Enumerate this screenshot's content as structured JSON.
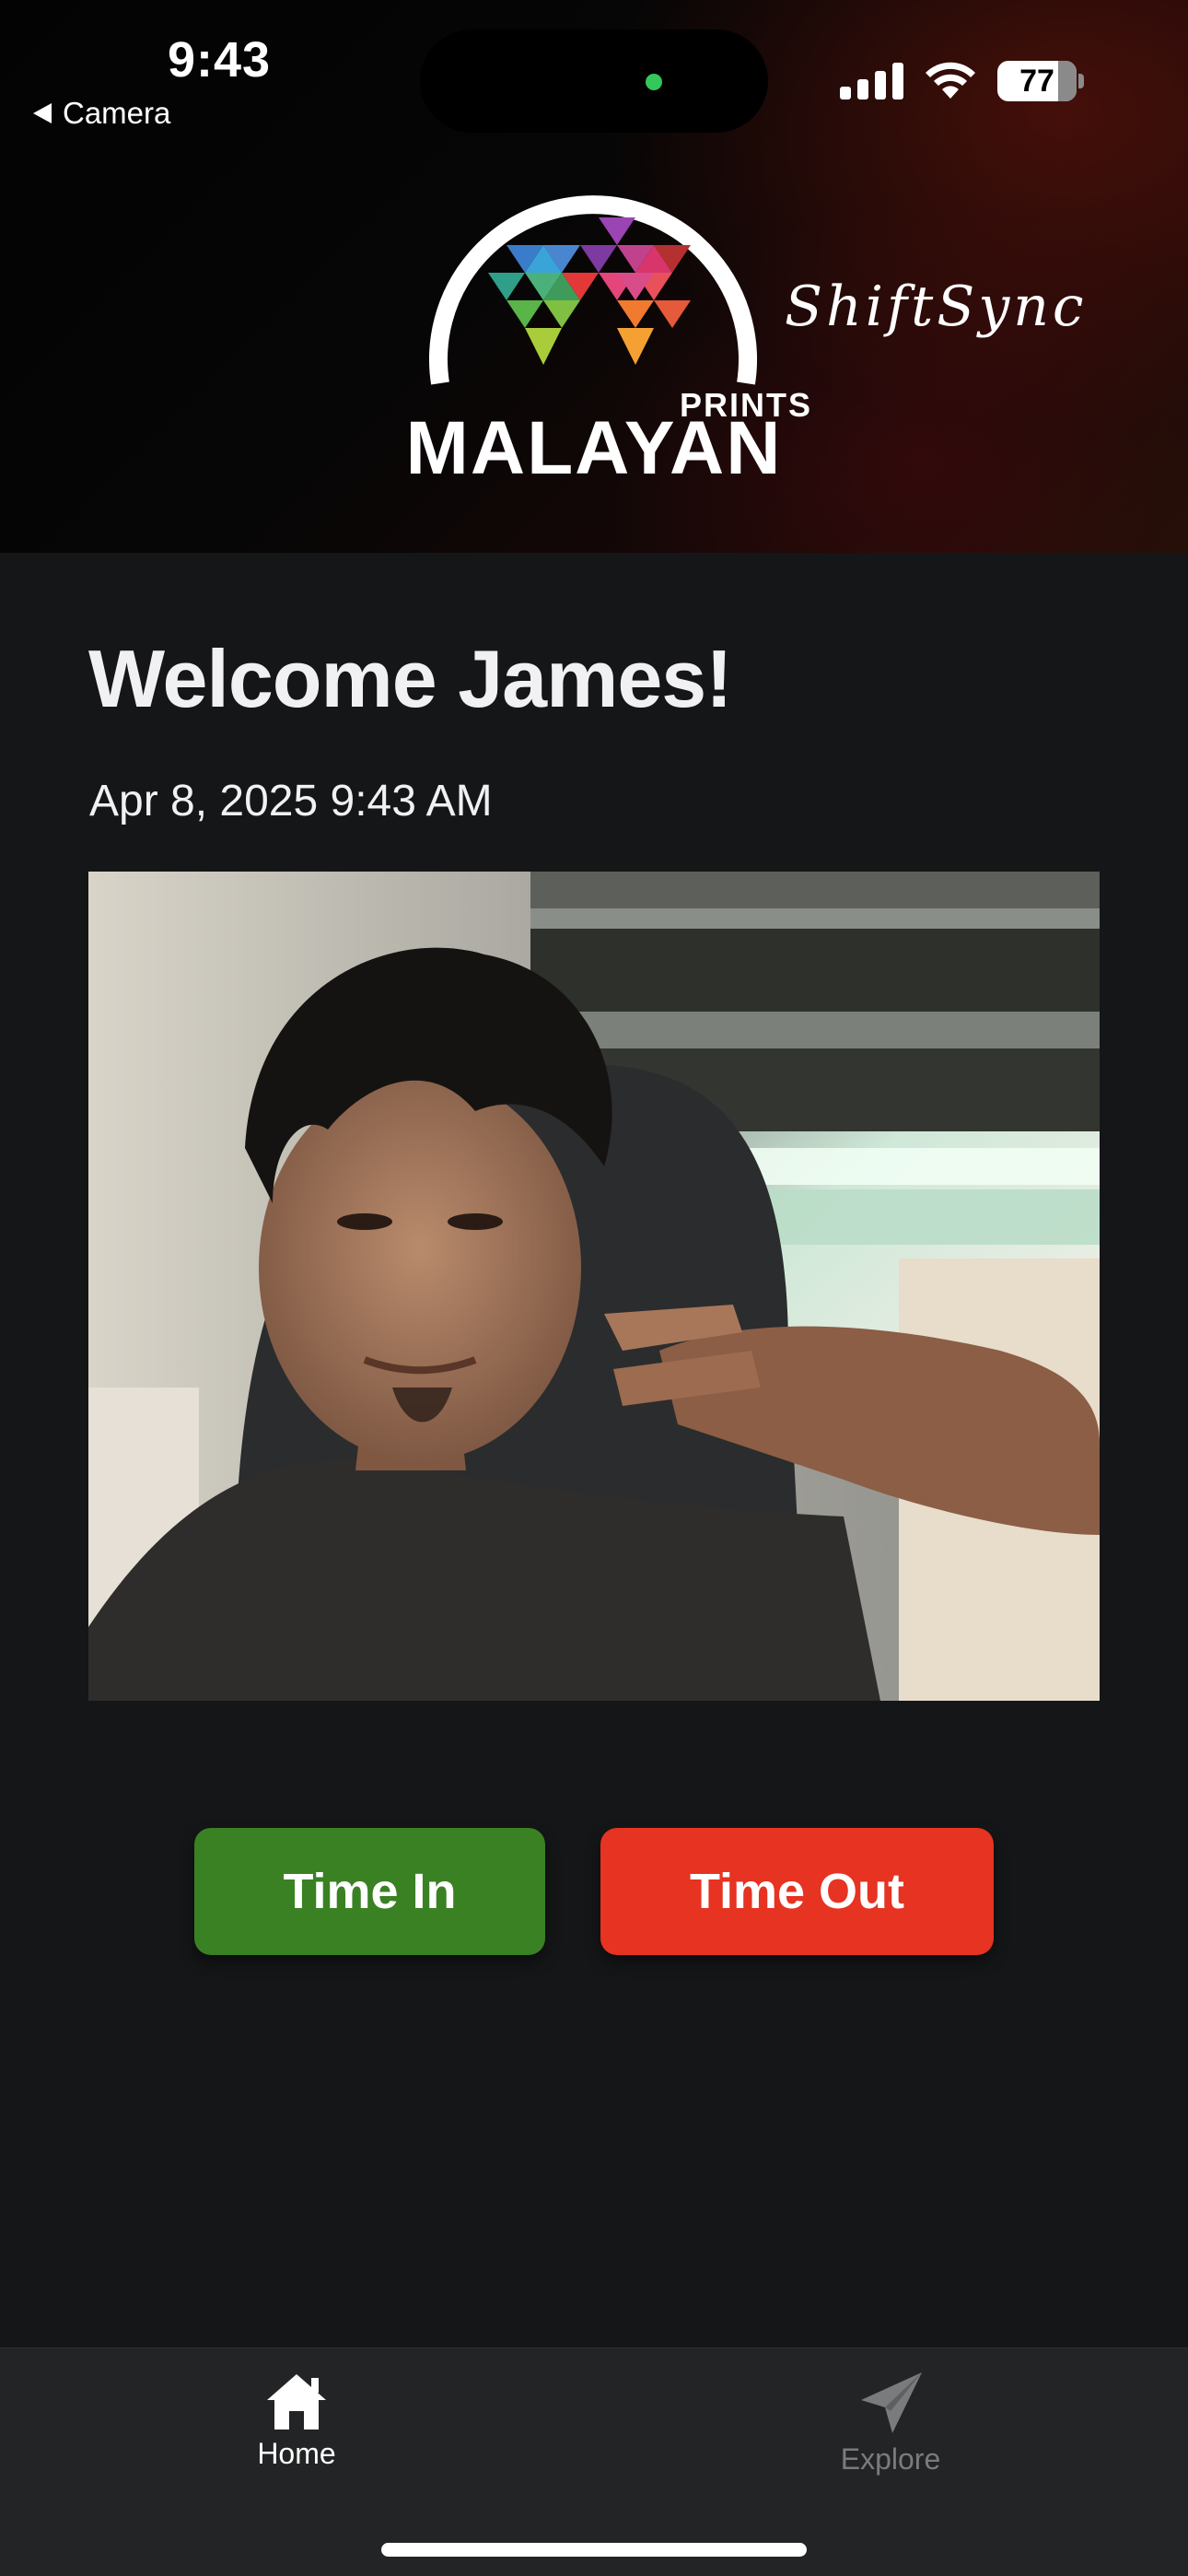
{
  "status_bar": {
    "time": "9:43",
    "back_label": "Camera",
    "battery": "77",
    "camera_in_use_color": "#34c759"
  },
  "header": {
    "logo_word": "MALAYAN",
    "logo_sub": "PRINTS",
    "app_name": "ShiftSync"
  },
  "main": {
    "welcome": "Welcome James!",
    "datetime": "Apr 8, 2025 9:43 AM"
  },
  "actions": {
    "time_in_label": "Time In",
    "time_in_color": "#3a8123",
    "time_out_label": "Time Out",
    "time_out_color": "#e63322"
  },
  "tabbar": {
    "home_label": "Home",
    "home_icon": "home-icon",
    "explore_label": "Explore",
    "explore_icon": "paper-plane-icon"
  }
}
